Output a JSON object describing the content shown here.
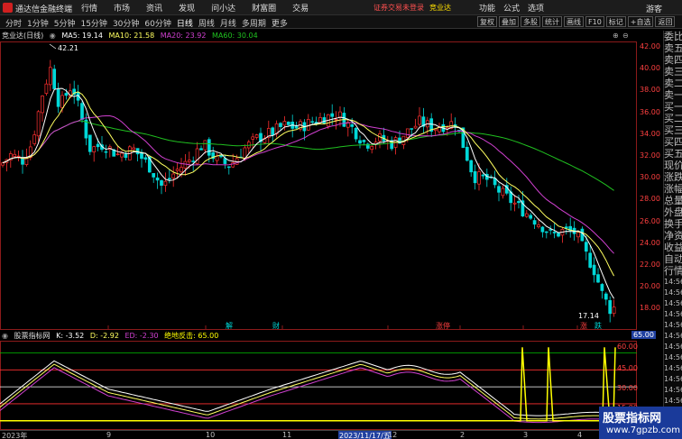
{
  "titlebar": {
    "app_name": "通达信金融终端",
    "menu": [
      "行情",
      "市场",
      "资讯",
      "发现",
      "问小达",
      "财富圈",
      "交易"
    ],
    "notice": "证券交易未登录",
    "stock_label": "竞业达",
    "right_menu": [
      "功能",
      "公式",
      "选项"
    ],
    "guest": "游客"
  },
  "toolbar": {
    "periods": [
      "分时",
      "1分钟",
      "5分钟",
      "15分钟",
      "30分钟",
      "60分钟",
      "日线",
      "周线",
      "月线",
      "多周期",
      "更多"
    ],
    "active_period": "日线",
    "tools": [
      "复权",
      "叠加",
      "多股",
      "统计",
      "画线",
      "F10",
      "标记",
      "+自选",
      "返回"
    ]
  },
  "chart_info": {
    "stock": "竞业达(日线)",
    "ma5": "MA5: 19.14",
    "ma10": "MA10: 21.58",
    "ma20": "MA20: 23.92",
    "ma60": "MA60: 30.04"
  },
  "price_axis": [
    "42.00",
    "40.00",
    "38.00",
    "36.00",
    "34.00",
    "32.00",
    "30.00",
    "28.00",
    "26.00",
    "24.00",
    "22.00",
    "20.00",
    "18.00"
  ],
  "annotations": {
    "high": "42.21",
    "low": "17.14",
    "event_jie": "解",
    "event_cai": "财",
    "event_zhangting": "涨停",
    "event_zhang": "涨",
    "event_die": "跌"
  },
  "side_panel": [
    "委比",
    "卖五",
    "卖四",
    "卖三",
    "卖二",
    "卖一",
    "买一",
    "买二",
    "买三",
    "买四",
    "买五",
    "现价",
    "涨跌",
    "涨幅",
    "总量",
    "外盘",
    "换手",
    "净资",
    "收益",
    "自动",
    "行情",
    "14:56",
    "14:56",
    "14:56",
    "14:56",
    "14:56",
    "14:56",
    "14:56",
    "14:56",
    "14:56",
    "14:56",
    "14:56",
    "14:56"
  ],
  "indicator": {
    "name": "股票指标网",
    "k": "K: -3.52",
    "d": "D: -2.92",
    "ed": "ED: -2.30",
    "signal": "绝地反击: 65.00",
    "levels": [
      "65.00",
      "60.00",
      "45.00",
      "30.00",
      "15.00"
    ]
  },
  "date_axis": [
    "2023年",
    "9",
    "10",
    "11",
    "2023/11/17/五",
    "12",
    "2",
    "3",
    "4"
  ],
  "colors": {
    "up": "#ff3030",
    "down": "#00d8d8",
    "ma5": "#ffffff",
    "ma10": "#ffff60",
    "ma20": "#d040d0",
    "ma60": "#20c020"
  },
  "watermark": {
    "line1": "股票指标网",
    "line2": "www.7gpzb.com"
  }
}
